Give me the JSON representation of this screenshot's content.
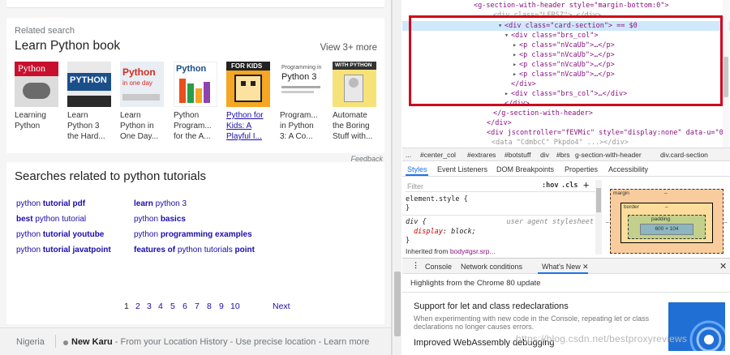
{
  "left": {
    "related": {
      "label": "Related search",
      "title": "Learn Python book",
      "view_more": "View 3+ more",
      "books": [
        {
          "title": "Learning Python",
          "lines": [
            "Learning",
            "Python"
          ],
          "cover_text": "Python",
          "cover_color": "#c8102e"
        },
        {
          "title": "Learn Python 3 the Hard...",
          "lines": [
            "Learn",
            "Python 3",
            "the Hard..."
          ],
          "cover_text": "PYTHON",
          "cover_color": "#1b4f8a"
        },
        {
          "title": "Learn Python in One Day...",
          "lines": [
            "Learn",
            "Python in",
            "One Day..."
          ],
          "cover_text": "Python",
          "cover_color": "#e8eef4"
        },
        {
          "title": "Python Program... for the A...",
          "lines": [
            "Python",
            "Program...",
            "for the A..."
          ],
          "cover_text": "Python",
          "cover_color": "#ffffff"
        },
        {
          "title": "Python for Kids: A Playful I...",
          "lines": [
            "Python for",
            "Kids: A",
            "Playful I..."
          ],
          "cover_text": "FOR KIDS",
          "cover_color": "#f5a623"
        },
        {
          "title": "Programming in Python 3: A Co...",
          "lines": [
            "Program...",
            "in Python",
            "3: A Co..."
          ],
          "cover_text": "Python 3",
          "cover_color": "#ffffff"
        },
        {
          "title": "Automate the Boring Stuff with...",
          "lines": [
            "Automate",
            "the Boring",
            "Stuff with..."
          ],
          "cover_text": "WITH PYTHON",
          "cover_color": "#f7e27a"
        }
      ]
    },
    "feedback": "Feedback",
    "searches": {
      "title": "Searches related to python tutorials",
      "items": [
        {
          "plain": "python ",
          "bold": "tutorial pdf",
          "suffix": ""
        },
        {
          "plain": "",
          "bold": "learn",
          "suffix": " python 3"
        },
        {
          "plain": "",
          "bold": "best",
          "suffix": " python tutorial"
        },
        {
          "plain": "python ",
          "bold": "basics",
          "suffix": ""
        },
        {
          "plain": "python ",
          "bold": "tutorial youtube",
          "suffix": ""
        },
        {
          "plain": "python ",
          "bold": "programming examples",
          "suffix": ""
        },
        {
          "plain": "python ",
          "bold": "tutorial javatpoint",
          "suffix": ""
        },
        {
          "plain": "",
          "bold": "features of",
          "suffix": " python tutorials ",
          "bold2": "point"
        }
      ]
    },
    "pager": {
      "pages": [
        "1",
        "2",
        "3",
        "4",
        "5",
        "6",
        "7",
        "8",
        "9",
        "10"
      ],
      "current": "1",
      "next": "Next"
    },
    "footer": {
      "country": "Nigeria",
      "place": "New Karu",
      "location_text": " - From your Location History - Use precise location - Learn more"
    }
  },
  "devtools": {
    "dom_lines": [
      {
        "text": "<g-section-with-header style=\"margin-bottom:0\">",
        "indent": 1
      },
      {
        "text": "<div class=\"card-section\"> == $0",
        "indent": 2
      },
      {
        "text": "<div class=\"brs_col\">",
        "indent": 3
      },
      {
        "text": "<p class=\"nVcaUb\">…</p>",
        "indent": 4
      },
      {
        "text": "<p class=\"nVcaUb\">…</p>",
        "indent": 4
      },
      {
        "text": "<p class=\"nVcaUb\">…</p>",
        "indent": 4
      },
      {
        "text": "<p class=\"nVcaUb\">…</p>",
        "indent": 4
      },
      {
        "text": "</div>",
        "indent": 3
      },
      {
        "text": "<div class=\"brs_col\">…</div>",
        "indent": 3
      },
      {
        "text": "</div>",
        "indent": 2
      },
      {
        "text": "</g-section-with-header>",
        "indent": 1
      },
      {
        "text": "</div>",
        "indent": 0
      },
      {
        "text": "<div jscontroller=\"fEVMic\" style=\"display:none\" data-u=\"0\"",
        "indent": 0
      }
    ],
    "breadcrumbs": [
      "...",
      "#center_col",
      "#extrares",
      "#botstuff",
      "div",
      "#brs",
      "g-section-with-header",
      "div.card-section"
    ],
    "style_tabs": [
      "Styles",
      "Event Listeners",
      "DOM Breakpoints",
      "Properties",
      "Accessibility"
    ],
    "styles": {
      "filter_placeholder": "Filter",
      "hov": ":hov",
      "cls": ".cls",
      "plus": "+",
      "element_style": "element.style {",
      "close_brace": "}",
      "rule_selector": "div {",
      "rule_source": "user agent stylesheet",
      "rule_prop": "display",
      "rule_value": "block;",
      "inherited_label": "Inherited from ",
      "inherited_link": "body#gsr.srp..."
    },
    "box_model": {
      "margin_label": "margin",
      "border_label": "border",
      "padding_label": "padding",
      "dash": "–",
      "content_size": "600 × 104"
    },
    "drawer_tabs": [
      "Console",
      "Network conditions",
      "What's New"
    ],
    "drawer_close": "✕",
    "whats_new": {
      "highlights": "Highlights from the Chrome 80 update",
      "items": [
        {
          "title": "Support for let and class redeclarations",
          "desc": "When experimenting with new code in the Console, repeating let or class declarations no longer causes errors."
        },
        {
          "title": "Improved WebAssembly debugging",
          "desc": ""
        }
      ]
    },
    "watermark": "https://blog.csdn.net/bestproxyreviews"
  },
  "colors": {
    "link": "#1a0dab",
    "highlight_box": "#d0021b",
    "selected_row": "#cfe8fc",
    "devtools_accent": "#1a73e8"
  }
}
